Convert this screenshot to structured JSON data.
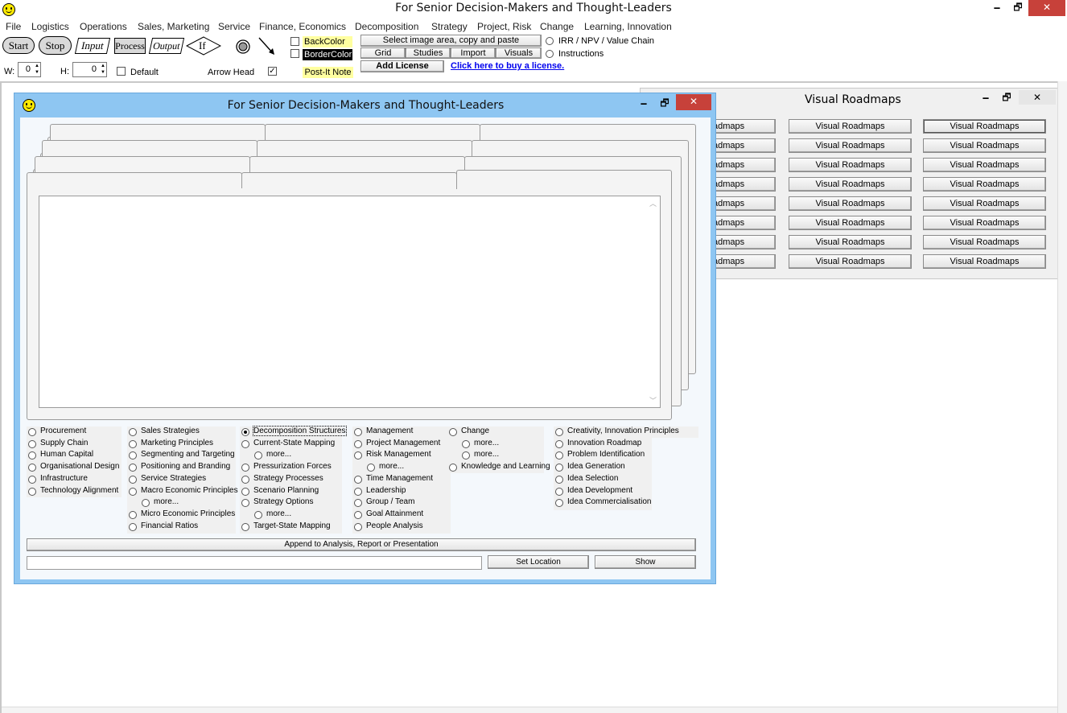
{
  "app": {
    "title": "For Senior Decision-Makers and Thought-Leaders",
    "win_min": "🗕",
    "win_restore": "🗗",
    "win_close": "✕"
  },
  "menu": [
    "File",
    "Logistics",
    "Operations",
    "Sales, Marketing",
    "Service",
    "Finance, Economics",
    "Decomposition",
    "Strategy",
    "Project, Risk",
    "Change",
    "Learning, Innovation"
  ],
  "toolbar": {
    "shapes": [
      "Start",
      "Stop",
      "Input",
      "Process",
      "Output",
      "If"
    ],
    "backcolor": "BackColor",
    "bordercolor": "BorderColor",
    "postit": "Post-It Note",
    "select_image": "Select image area, copy and paste",
    "grid": "Grid",
    "studies": "Studies",
    "import": "Import",
    "visuals": "Visuals",
    "add_license": "Add License",
    "buy_link": "Click here to buy a license.",
    "irr": "IRR / NPV / Value Chain",
    "instructions": "Instructions",
    "w_label": "W:",
    "w_value": "0",
    "h_label": "H:",
    "h_value": "0",
    "default_label": "Default",
    "arrow_head_label": "Arrow Head"
  },
  "roadmaps": {
    "title": "Visual Roadmaps",
    "partial": "admaps",
    "button": "Visual Roadmaps"
  },
  "dialog": {
    "title": "For Senior Decision-Makers and Thought-Leaders",
    "append": "Append to Analysis, Report or Presentation",
    "set_location": "Set Location",
    "show": "Show",
    "location_value": ""
  },
  "options": {
    "col1": [
      "Procurement",
      "Supply Chain",
      "Human Capital",
      "Organisational Design",
      "Infrastructure",
      "Technology Alignment"
    ],
    "col2": [
      "Sales Strategies",
      "Marketing Principles",
      "Segmenting and Targeting",
      "Positioning and Branding",
      "Service Strategies",
      "Macro Economic Principles",
      "more...",
      "Micro Economic Principles",
      "Financial Ratios"
    ],
    "col3": [
      "Decomposition Structures",
      "Current-State Mapping",
      "more...",
      "Pressurization Forces",
      "Strategy Processes",
      "Scenario Planning",
      "Strategy Options",
      "more...",
      "Target-State Mapping"
    ],
    "col4": [
      "Management",
      "Project Management",
      "Risk Management",
      "more...",
      "Time Management",
      "Leadership",
      "Group / Team",
      "Goal Attainment",
      "People Analysis"
    ],
    "col5": [
      "Change",
      "more...",
      "more...",
      "Knowledge and Learning"
    ],
    "col6": [
      "Creativity, Innovation Principles",
      "Innovation Roadmap",
      "Problem Identification",
      "Idea Generation",
      "Idea Selection",
      "Idea Development",
      "Idea Commercialisation"
    ]
  },
  "colors": {
    "dialog_frame": "#8ec6f2",
    "backcolor_bg": "#ffffa0",
    "bordercolor_bg": "#000000",
    "link": "#0000ee"
  }
}
